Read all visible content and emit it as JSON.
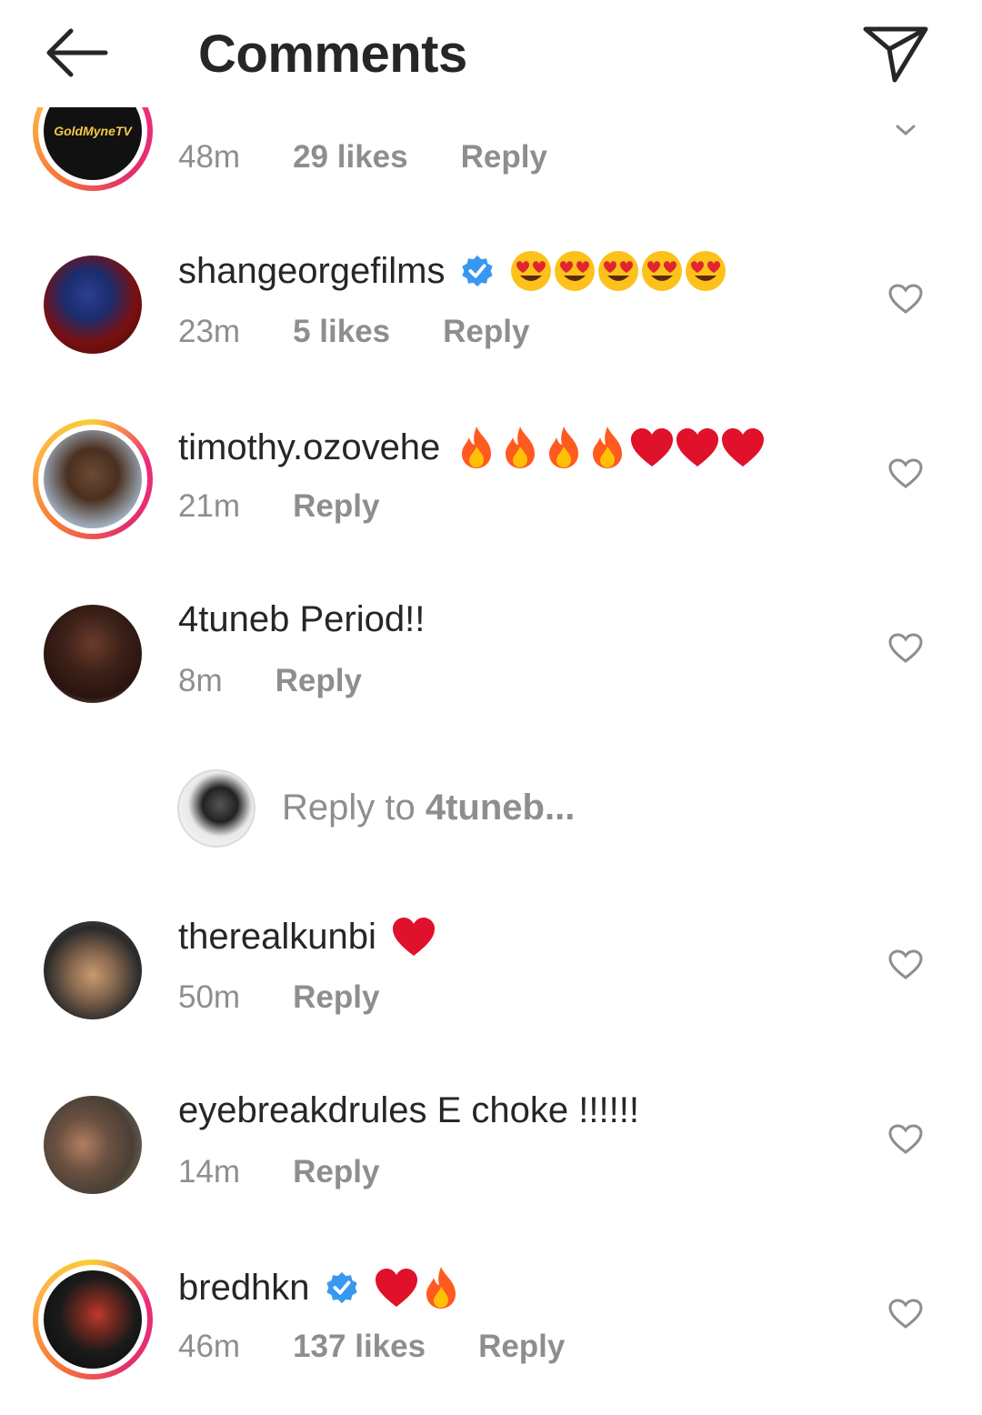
{
  "header": {
    "title": "Comments"
  },
  "comments": [
    {
      "username": "",
      "text": "",
      "time": "48m",
      "likes": "29 likes",
      "reply": "Reply",
      "avatar_label": "GoldMyneTV"
    },
    {
      "username": "shangeorgefilms",
      "text": "",
      "time": "23m",
      "likes": "5 likes",
      "reply": "Reply"
    },
    {
      "username": "timothy.ozovehe",
      "text": "",
      "time": "21m",
      "likes": "",
      "reply": "Reply"
    },
    {
      "username": "4tuneb",
      "text": "Period!!",
      "time": "8m",
      "likes": "",
      "reply": "Reply"
    },
    {
      "username": "therealkunbi",
      "text": "",
      "time": "50m",
      "likes": "",
      "reply": "Reply"
    },
    {
      "username": "eyebreakdrules",
      "text": "E choke !!!!!!",
      "time": "14m",
      "likes": "",
      "reply": "Reply"
    },
    {
      "username": "bredhkn",
      "text": "",
      "time": "46m",
      "likes": "137 likes",
      "reply": "Reply"
    }
  ],
  "reply_box": {
    "prefix": "Reply to ",
    "target": "4tuneb..."
  },
  "icons": {
    "back": "arrow-left-icon",
    "send": "paper-plane-icon",
    "like": "heart-outline-icon",
    "verified": "verified-badge-icon"
  },
  "colors": {
    "muted": "#8e8e8e",
    "verified": "#3897f0",
    "text": "#262626"
  }
}
